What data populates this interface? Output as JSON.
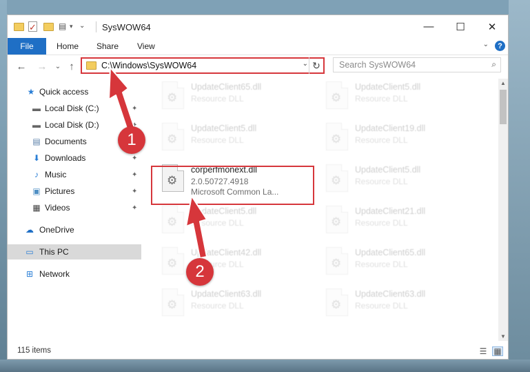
{
  "window": {
    "title": "SysWOW64",
    "controls": {
      "minimize": "—",
      "maximize": "☐",
      "close": "✕"
    }
  },
  "ribbon": {
    "tabs": [
      "File",
      "Home",
      "Share",
      "View"
    ],
    "help": "?",
    "collapse": "⌄"
  },
  "navigation": {
    "back": "←",
    "forward": "→",
    "recent": "⌄",
    "up": "↑",
    "address": "C:\\Windows\\SysWOW64",
    "address_drop": "⌄",
    "refresh": "↻",
    "search_placeholder": "Search SysWOW64",
    "search_icon": "⌕"
  },
  "sidebar": {
    "items": [
      {
        "label": "Quick access",
        "icon": "★",
        "pinned": false
      },
      {
        "label": "Local Disk (C:)",
        "icon": "▬",
        "pinned": true
      },
      {
        "label": "Local Disk (D:)",
        "icon": "▬",
        "pinned": true
      },
      {
        "label": "Documents",
        "icon": "▤",
        "pinned": true
      },
      {
        "label": "Downloads",
        "icon": "⬇",
        "pinned": true
      },
      {
        "label": "Music",
        "icon": "♪",
        "pinned": true
      },
      {
        "label": "Pictures",
        "icon": "▣",
        "pinned": true
      },
      {
        "label": "Videos",
        "icon": "▦",
        "pinned": true
      },
      {
        "label": "OneDrive",
        "icon": "☁",
        "pinned": false
      },
      {
        "label": "This PC",
        "icon": "▭",
        "pinned": false,
        "selected": true
      },
      {
        "label": "Network",
        "icon": "⊞",
        "pinned": false
      }
    ],
    "pin_glyph": "✦"
  },
  "files": {
    "left_column": [
      {
        "name": "UpdateClient65.dll",
        "sub1": "Resource DLL"
      },
      {
        "name": "UpdateClient5.dll",
        "sub1": "Resource DLL"
      },
      {
        "name": "corperfmonext.dll",
        "sub1": "2.0.50727.4918",
        "sub2": "Microsoft Common La...",
        "highlighted": true
      },
      {
        "name": "UpdateClient5.dll",
        "sub1": "Resource DLL"
      },
      {
        "name": "UpdateClient42.dll",
        "sub1": "Resource DLL"
      },
      {
        "name": "UpdateClient63.dll",
        "sub1": "Resource DLL"
      }
    ],
    "right_column": [
      {
        "name": "UpdateClient5.dll",
        "sub1": "Resource DLL"
      },
      {
        "name": "UpdateClient19.dll",
        "sub1": "Resource DLL"
      },
      {
        "name": "UpdateClient5.dll",
        "sub1": "Resource DLL"
      },
      {
        "name": "UpdateClient21.dll",
        "sub1": "Resource DLL"
      },
      {
        "name": "UpdateClient65.dll",
        "sub1": "Resource DLL"
      },
      {
        "name": "UpdateClient63.dll",
        "sub1": "Resource DLL"
      }
    ],
    "gear_glyph": "⚙"
  },
  "status": {
    "count": "115 items",
    "details_view": "☰",
    "large_icons_view": "▦"
  },
  "annotations": {
    "step1": "1",
    "step2": "2",
    "color": "#d6363b"
  }
}
